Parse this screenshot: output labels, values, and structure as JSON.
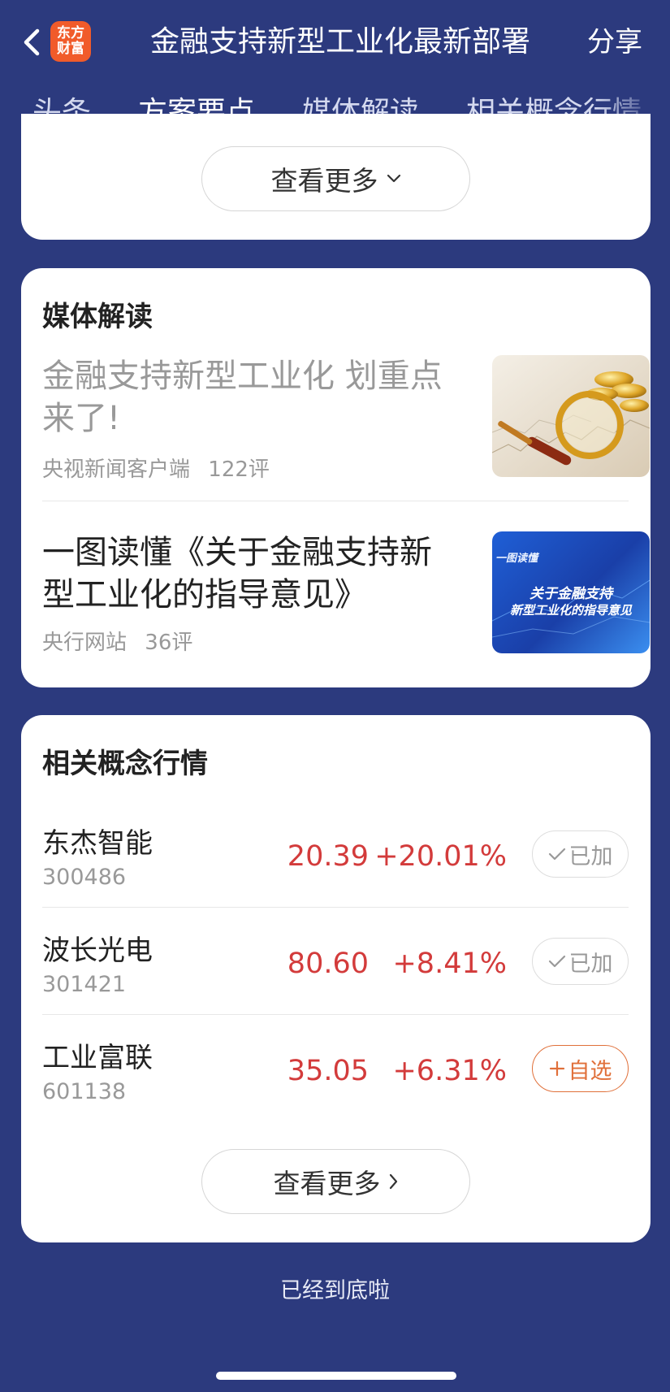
{
  "header": {
    "logo_line1": "东方",
    "logo_line2": "财富",
    "title": "金融支持新型工业化最新部署",
    "share_label": "分享"
  },
  "tabs": [
    {
      "label": "头条",
      "active": false
    },
    {
      "label": "方案要点",
      "active": true
    },
    {
      "label": "媒体解读",
      "active": false
    },
    {
      "label": "相关概念行情",
      "active": false
    }
  ],
  "plan_section": {
    "more_label": "查看更多"
  },
  "media_section": {
    "title": "媒体解读",
    "articles": [
      {
        "title": "金融支持新型工业化 划重点来了!",
        "source": "央视新闻客户端",
        "comments": "122评",
        "read": true,
        "thumb": "gold-coins-magnifier-image"
      },
      {
        "title": "一图读懂《关于金融支持新型工业化的指导意见》",
        "source": "央行网站",
        "comments": "36评",
        "read": false,
        "thumb_tag": "一图读懂",
        "thumb_line1": "关于金融支持",
        "thumb_line2": "新型工业化的指导意见"
      }
    ]
  },
  "concept_section": {
    "title": "相关概念行情",
    "stocks": [
      {
        "name": "东杰智能",
        "code": "300486",
        "price": "20.39",
        "change": "+20.01%",
        "watch_label": "已加",
        "added": true
      },
      {
        "name": "波长光电",
        "code": "301421",
        "price": "80.60",
        "change": "+8.41%",
        "watch_label": "已加",
        "added": true
      },
      {
        "name": "工业富联",
        "code": "601138",
        "price": "35.05",
        "change": "+6.31%",
        "watch_label": "自选",
        "added": false
      }
    ],
    "more_label": "查看更多"
  },
  "footer": {
    "end_note": "已经到底啦"
  },
  "colors": {
    "background": "#2c3a7e",
    "up_red": "#d33b3b",
    "accent_orange": "#e0703a",
    "logo": "#f15b2a"
  }
}
